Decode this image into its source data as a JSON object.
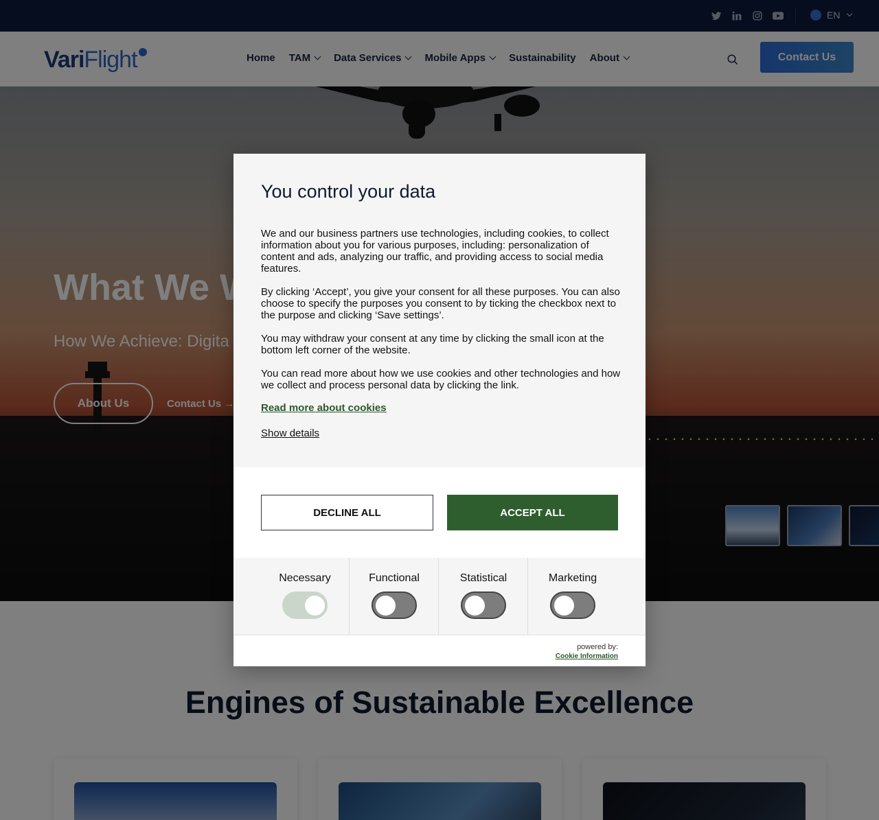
{
  "topbar": {
    "social_icons": [
      "twitter-icon",
      "linkedin-icon",
      "instagram-icon",
      "youtube-icon"
    ],
    "language": "EN"
  },
  "header": {
    "logo": {
      "part1": "Vari",
      "part2": "Flight"
    },
    "nav": [
      {
        "label": "Home",
        "has_dropdown": false
      },
      {
        "label": "TAM",
        "has_dropdown": true
      },
      {
        "label": "Data Services",
        "has_dropdown": true
      },
      {
        "label": "Mobile Apps",
        "has_dropdown": true
      },
      {
        "label": "Sustainability",
        "has_dropdown": false
      },
      {
        "label": "About",
        "has_dropdown": true
      }
    ],
    "contact_label": "Contact Us"
  },
  "hero": {
    "title": "What We W",
    "subtitle": "How We Achieve: Digita",
    "about_label": "About Us",
    "contact_label": "Contact Us →"
  },
  "section": {
    "engines_title": "Engines of Sustainable Excellence"
  },
  "consent": {
    "title": "You control your data",
    "paragraphs": [
      "We and our business partners use technologies, including cookies, to collect information about you for various purposes, including: personalization of content and ads, analyzing our traffic, and providing access to social media features.",
      "By clicking ‘Accept’, you give your consent for all these purposes. You can also choose to specify the purposes you consent to by ticking the checkbox next to the purpose and clicking ‘Save settings’.",
      "You may withdraw your consent at any time by clicking the small icon at the bottom left corner of the website.",
      "You can read more about how we use cookies and other technologies and how we collect and process personal data by clicking the link."
    ],
    "read_more": "Read more about cookies",
    "show_details": "Show details",
    "decline_label": "DECLINE ALL",
    "accept_label": "ACCEPT ALL",
    "categories": [
      {
        "label": "Necessary",
        "enabled": true
      },
      {
        "label": "Functional",
        "enabled": false
      },
      {
        "label": "Statistical",
        "enabled": false
      },
      {
        "label": "Marketing",
        "enabled": false
      }
    ],
    "powered_by": "powered by:",
    "provider": "Cookie Information"
  },
  "colors": {
    "topbar_bg": "#0d1b3e",
    "brand_blue": "#2e67c5",
    "accept_green": "#2f5e2e"
  }
}
